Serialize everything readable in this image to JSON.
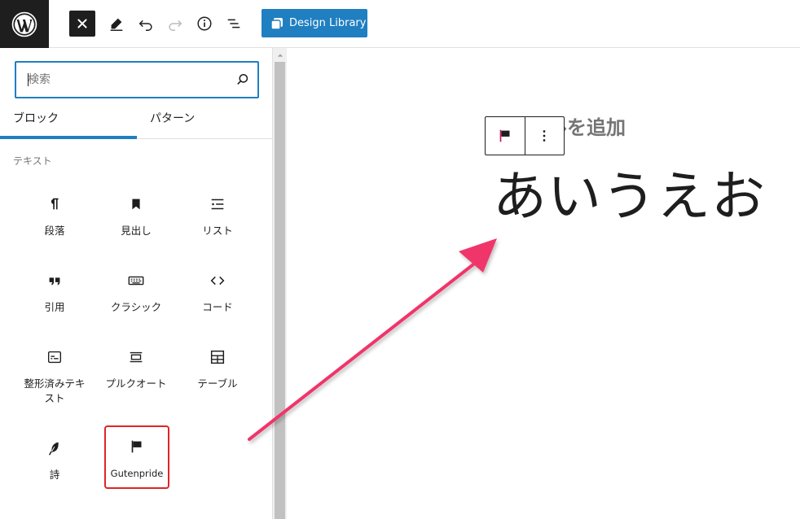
{
  "colors": {
    "accent": "#1f7fc1",
    "dark": "#1e1e1e",
    "highlight_border": "#e02424",
    "arrow": "#f0346b"
  },
  "toolbar": {
    "logo_icon": "wordpress-logo",
    "close_icon": "close-icon",
    "edit_icon": "pencil-icon",
    "undo_icon": "undo-icon",
    "redo_icon": "redo-icon",
    "info_icon": "info-icon",
    "list_view_icon": "list-view-icon",
    "design_library_label": "Design Library"
  },
  "sidebar": {
    "search": {
      "placeholder": "検索",
      "value": ""
    },
    "tabs": [
      {
        "label": "ブロック",
        "active": true
      },
      {
        "label": "パターン",
        "active": false
      }
    ],
    "category": "テキスト",
    "blocks": [
      {
        "label": "段落",
        "icon": "paragraph-icon"
      },
      {
        "label": "見出し",
        "icon": "heading-bookmark-icon"
      },
      {
        "label": "リスト",
        "icon": "list-icon"
      },
      {
        "label": "引用",
        "icon": "quote-icon"
      },
      {
        "label": "クラシック",
        "icon": "keyboard-icon"
      },
      {
        "label": "コード",
        "icon": "code-icon"
      },
      {
        "label": "整形済みテキスト",
        "icon": "preformatted-icon"
      },
      {
        "label": "プルクオート",
        "icon": "pullquote-icon"
      },
      {
        "label": "テーブル",
        "icon": "table-icon"
      },
      {
        "label": "詩",
        "icon": "feather-icon"
      },
      {
        "label": "Gutenpride",
        "icon": "flag-icon",
        "highlighted": true
      }
    ]
  },
  "editor": {
    "title_placeholder": "タイトルを追加",
    "heading_text": "あいうえお"
  }
}
